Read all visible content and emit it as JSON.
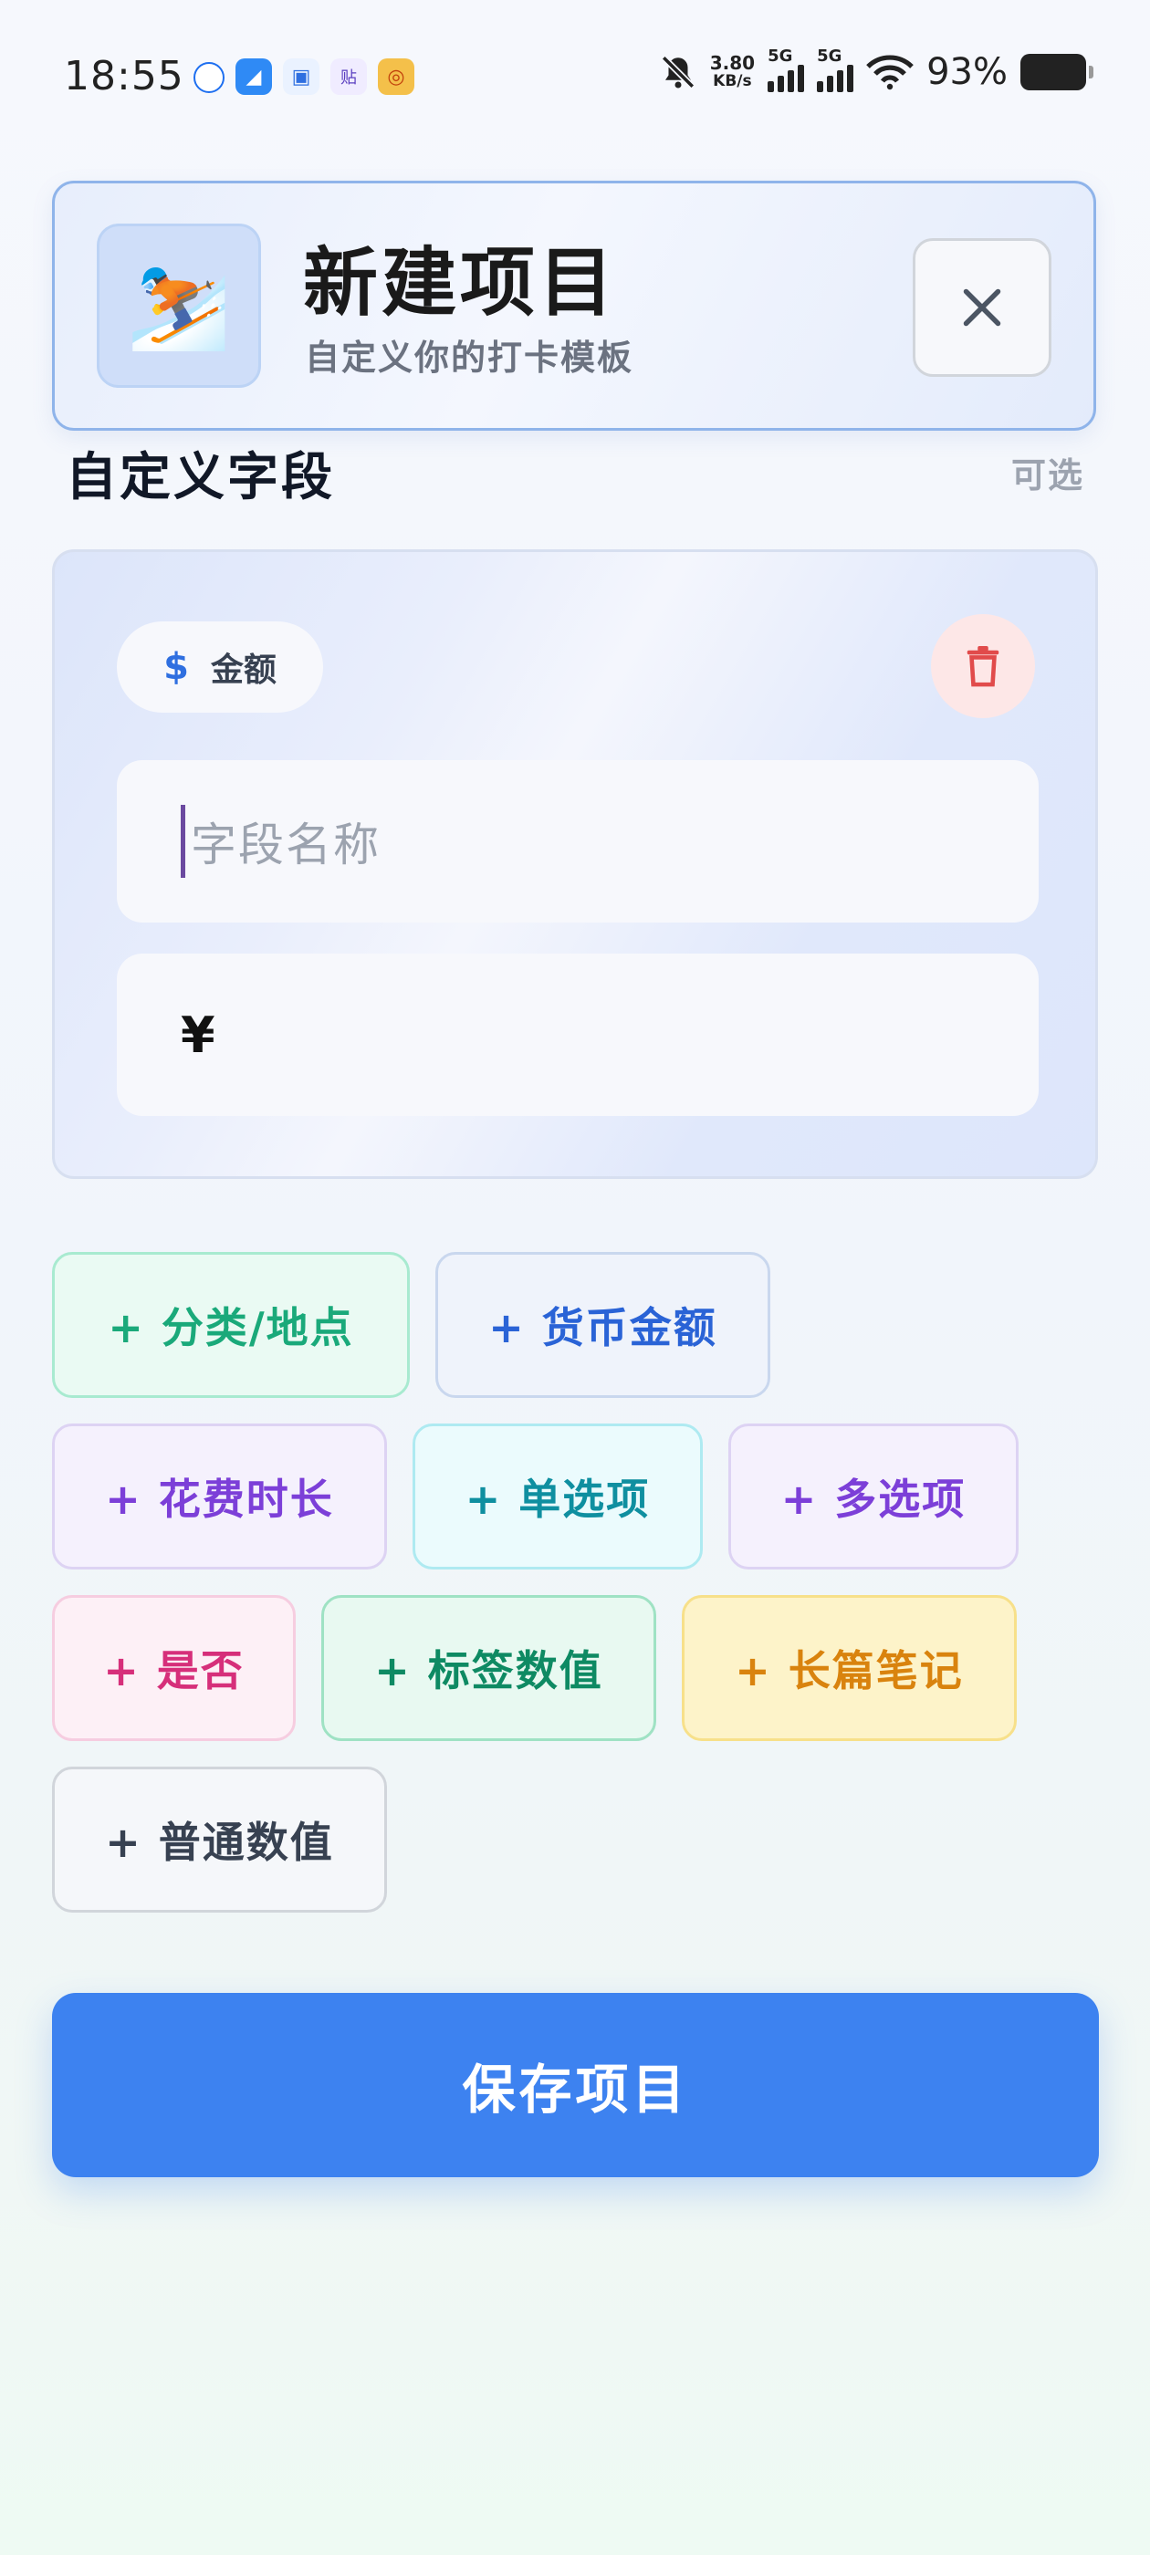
{
  "status_bar": {
    "time": "18:55",
    "net_speed_value": "3.80",
    "net_speed_unit": "KB/s",
    "signal1_label": "5G",
    "signal2_label": "5G",
    "battery_percent": "93%"
  },
  "header": {
    "emoji": "⛷️",
    "title": "新建项目",
    "subtitle": "自定义你的打卡模板"
  },
  "section": {
    "title": "自定义字段",
    "hint": "可选"
  },
  "field_card": {
    "type_icon": "$",
    "type_label": "金额",
    "name_placeholder": "字段名称",
    "currency_symbol": "¥"
  },
  "add_field_chips": [
    {
      "label": "+ 分类/地点",
      "color": "#1aa97a",
      "border": "#a8ead0",
      "bg": "#eafaf3"
    },
    {
      "label": "+ 货币金额",
      "color": "#2a63d6",
      "border": "#c9d7ee",
      "bg": "#eff3fb"
    },
    {
      "label": "+ 花费时长",
      "color": "#7c3fd8",
      "border": "#ddd3f3",
      "bg": "#f5f1fd"
    },
    {
      "label": "+ 单选项",
      "color": "#0f8fa0",
      "border": "#aeeaf1",
      "bg": "#ebfbfd"
    },
    {
      "label": "+ 多选项",
      "color": "#7c3fd8",
      "border": "#ddd3f3",
      "bg": "#f5f1fd"
    },
    {
      "label": "+ 是否",
      "color": "#d62f7a",
      "border": "#f6cde0",
      "bg": "#fdf0f6"
    },
    {
      "label": "+ 标签数值",
      "color": "#0e8a63",
      "border": "#9fe2c4",
      "bg": "#e8f9f1"
    },
    {
      "label": "+ 长篇笔记",
      "color": "#d9830e",
      "border": "#f7e08a",
      "bg": "#fdf3c9"
    },
    {
      "label": "+ 普通数值",
      "color": "#374151",
      "border": "#d1d5db",
      "bg": "#f5f7fa"
    }
  ],
  "save_button_label": "保存项目",
  "colors": {
    "primary": "#3d82f0",
    "delete_icon": "#e14b4b",
    "delete_bg": "#fde7e7"
  }
}
